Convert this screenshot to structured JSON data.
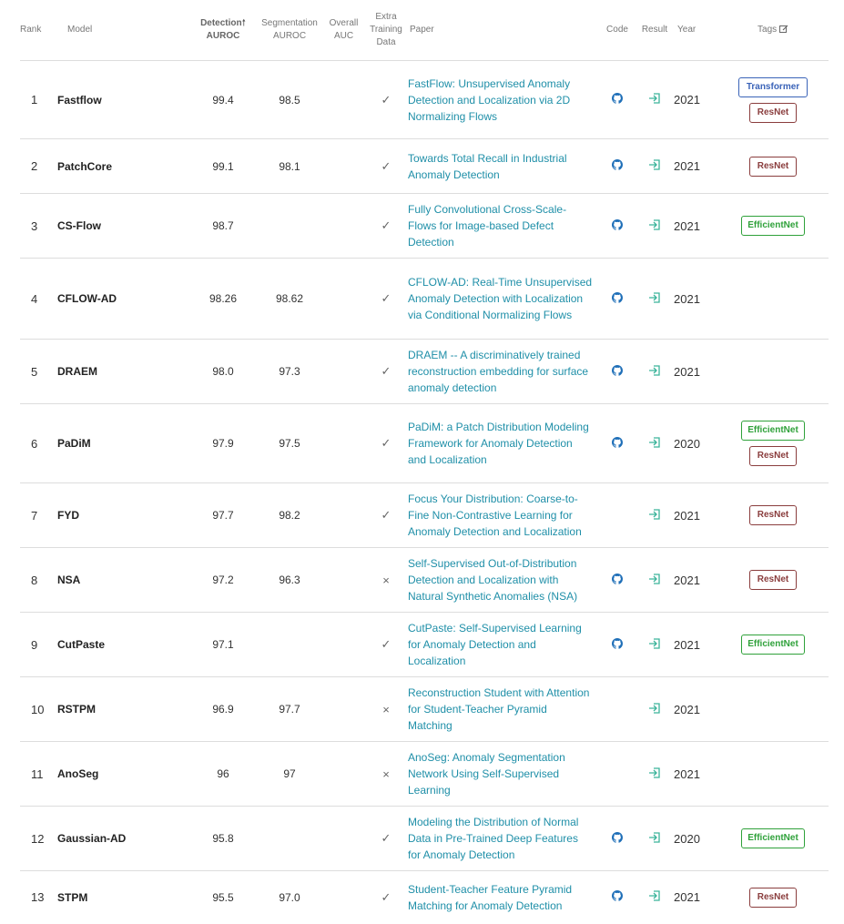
{
  "headers": {
    "rank": "Rank",
    "model": "Model",
    "detection_line1": "Detection",
    "detection_line2": "AUROC",
    "detection_sort_icon": "up-arrow",
    "segmentation_line1": "Segmentation",
    "segmentation_line2": "AUROC",
    "overall_line1": "Overall",
    "overall_line2": "AUC",
    "extra_line1": "Extra",
    "extra_line2": "Training",
    "extra_line3": "Data",
    "paper": "Paper",
    "code": "Code",
    "result": "Result",
    "year": "Year",
    "tags": "Tags",
    "tags_icon": "edit-icon"
  },
  "colors": {
    "link": "#1f8fa8",
    "transformer": "#3a63b8",
    "resnet": "#8a3d3d",
    "efficientnet": "#2fa13a",
    "github": "#1f6fb8",
    "result": "#3bb39a"
  },
  "rows": [
    {
      "rank": "1",
      "model": "Fastflow",
      "detection": "99.4",
      "segmentation": "98.5",
      "extra": "✓",
      "paper": "FastFlow: Unsupervised Anomaly Detection and Localization via 2D Normalizing Flows",
      "code": true,
      "result": true,
      "year": "2021",
      "tags": [
        "Transformer",
        "ResNet"
      ]
    },
    {
      "rank": "2",
      "model": "PatchCore",
      "detection": "99.1",
      "segmentation": "98.1",
      "extra": "✓",
      "paper": "Towards Total Recall in Industrial Anomaly Detection",
      "code": true,
      "result": true,
      "year": "2021",
      "tags": [
        "ResNet"
      ]
    },
    {
      "rank": "3",
      "model": "CS-Flow",
      "detection": "98.7",
      "segmentation": "",
      "extra": "✓",
      "paper": "Fully Convolutional Cross-Scale-Flows for Image-based Defect Detection",
      "code": true,
      "result": true,
      "year": "2021",
      "tags": [
        "EfficientNet"
      ]
    },
    {
      "rank": "4",
      "model": "CFLOW-AD",
      "detection": "98.26",
      "segmentation": "98.62",
      "extra": "✓",
      "paper": "CFLOW-AD: Real-Time Unsupervised Anomaly Detection with Localization via Conditional Normalizing Flows",
      "code": true,
      "result": true,
      "year": "2021",
      "tags": []
    },
    {
      "rank": "5",
      "model": "DRAEM",
      "detection": "98.0",
      "segmentation": "97.3",
      "extra": "✓",
      "paper": "DRAEM -- A discriminatively trained reconstruction embedding for surface anomaly detection",
      "code": true,
      "result": true,
      "year": "2021",
      "tags": []
    },
    {
      "rank": "6",
      "model": "PaDiM",
      "detection": "97.9",
      "segmentation": "97.5",
      "extra": "✓",
      "paper": "PaDiM: a Patch Distribution Modeling Framework for Anomaly Detection and Localization",
      "code": true,
      "result": true,
      "year": "2020",
      "tags": [
        "EfficientNet",
        "ResNet"
      ]
    },
    {
      "rank": "7",
      "model": "FYD",
      "detection": "97.7",
      "segmentation": "98.2",
      "extra": "✓",
      "paper": "Focus Your Distribution: Coarse-to-Fine Non-Contrastive Learning for Anomaly Detection and Localization",
      "code": false,
      "result": true,
      "year": "2021",
      "tags": [
        "ResNet"
      ]
    },
    {
      "rank": "8",
      "model": "NSA",
      "detection": "97.2",
      "segmentation": "96.3",
      "extra": "×",
      "paper": "Self-Supervised Out-of-Distribution Detection and Localization with Natural Synthetic Anomalies (NSA)",
      "code": true,
      "result": true,
      "year": "2021",
      "tags": [
        "ResNet"
      ]
    },
    {
      "rank": "9",
      "model": "CutPaste",
      "detection": "97.1",
      "segmentation": "",
      "extra": "✓",
      "paper": "CutPaste: Self-Supervised Learning for Anomaly Detection and Localization",
      "code": true,
      "result": true,
      "year": "2021",
      "tags": [
        "EfficientNet"
      ]
    },
    {
      "rank": "10",
      "model": "RSTPM",
      "detection": "96.9",
      "segmentation": "97.7",
      "extra": "×",
      "paper": "Reconstruction Student with Attention for Student-Teacher Pyramid Matching",
      "code": false,
      "result": true,
      "year": "2021",
      "tags": []
    },
    {
      "rank": "11",
      "model": "AnoSeg",
      "detection": "96",
      "segmentation": "97",
      "extra": "×",
      "paper": "AnoSeg: Anomaly Segmentation Network Using Self-Supervised Learning",
      "code": false,
      "result": true,
      "year": "2021",
      "tags": []
    },
    {
      "rank": "12",
      "model": "Gaussian-AD",
      "detection": "95.8",
      "segmentation": "",
      "extra": "✓",
      "paper": "Modeling the Distribution of Normal Data in Pre-Trained Deep Features for Anomaly Detection",
      "code": true,
      "result": true,
      "year": "2020",
      "tags": [
        "EfficientNet"
      ]
    },
    {
      "rank": "13",
      "model": "STPM",
      "detection": "95.5",
      "segmentation": "97.0",
      "extra": "✓",
      "paper": "Student-Teacher Feature Pyramid Matching for Anomaly Detection",
      "code": true,
      "result": true,
      "year": "2021",
      "tags": [
        "ResNet"
      ]
    }
  ]
}
